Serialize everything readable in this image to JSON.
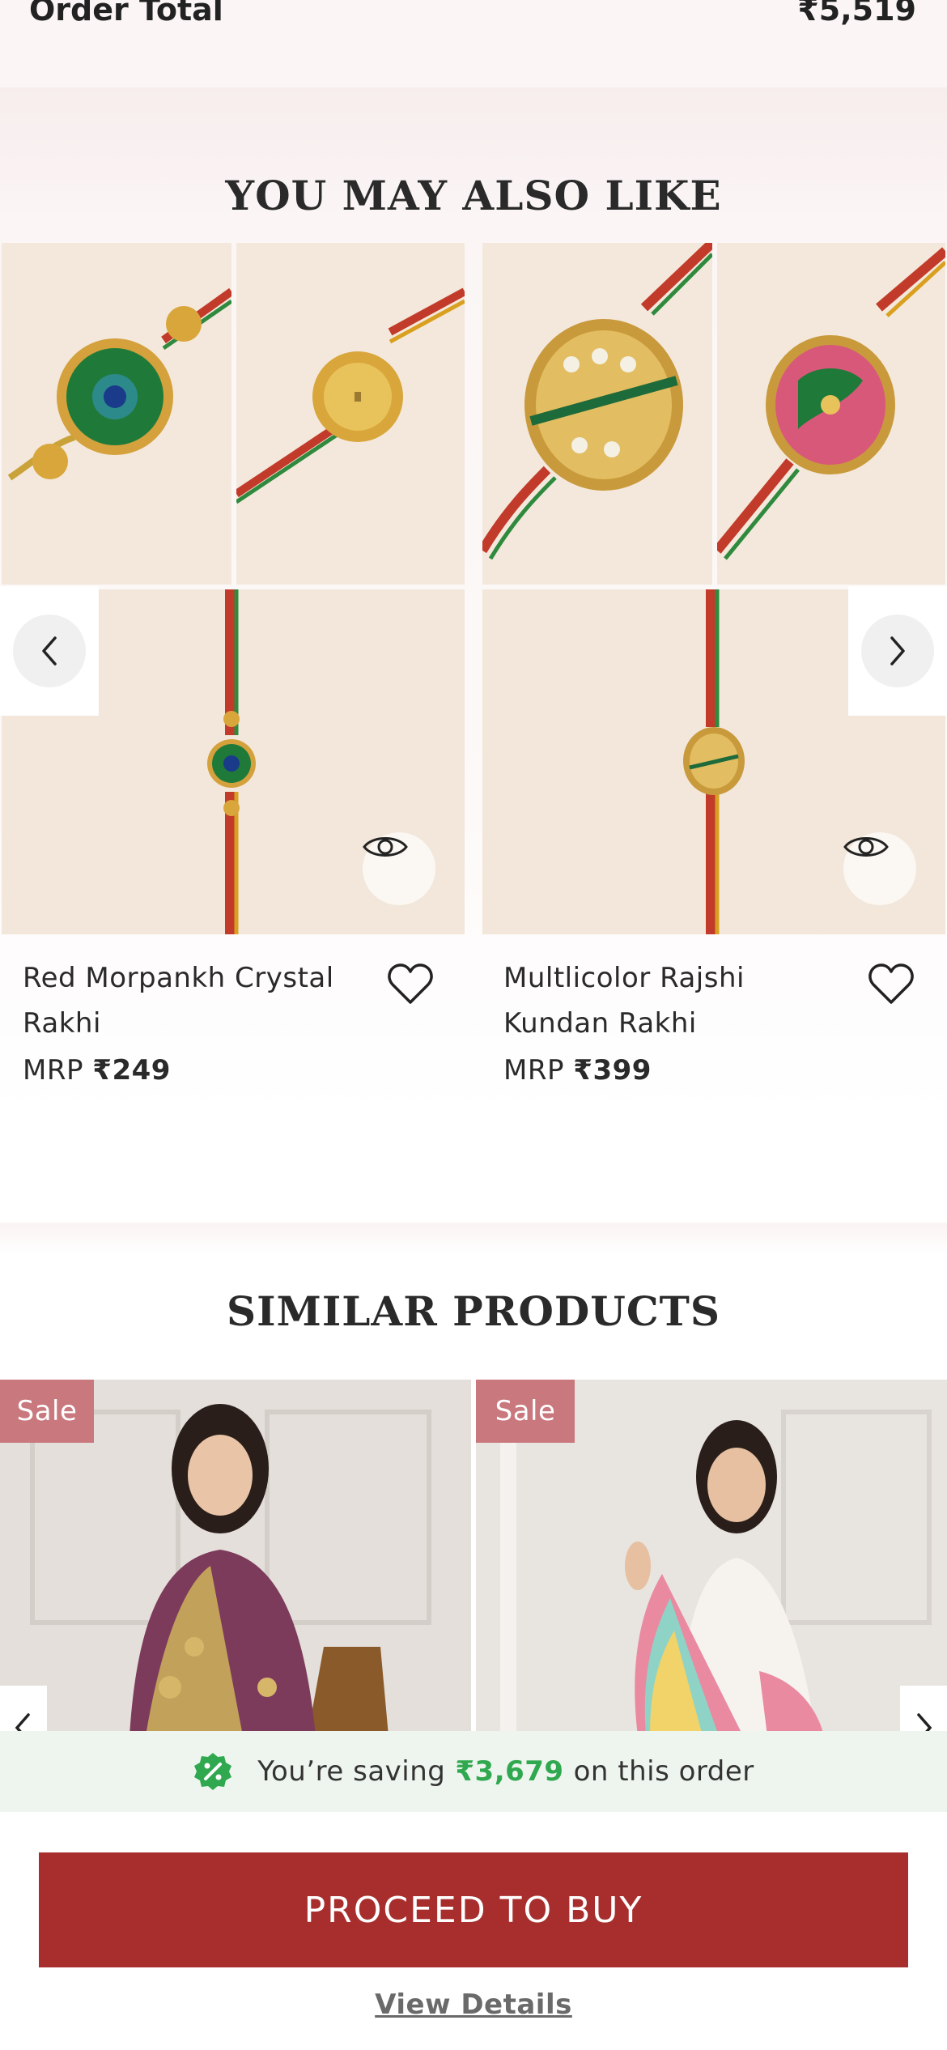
{
  "order_summary": {
    "label": "Order Total",
    "value": "₹5,519"
  },
  "you_may_also_like": {
    "title": "YOU MAY ALSO LIKE",
    "products": [
      {
        "name": "Red Morpankh Crystal Rakhi",
        "price_prefix": "MRP",
        "price": "₹249"
      },
      {
        "name": "Multlicolor Rajshi Kundan Rakhi",
        "price_prefix": "MRP",
        "price": "₹399"
      }
    ]
  },
  "similar_products": {
    "title": "SIMILAR PRODUCTS",
    "badges": [
      "Sale",
      "Sale"
    ]
  },
  "savings": {
    "prefix": "You’re saving",
    "amount": "₹3,679",
    "suffix": "on this order"
  },
  "actions": {
    "buy_label": "PROCEED TO BUY",
    "details_label": "View Details"
  },
  "colors": {
    "accent": "#a82e2e",
    "savings_green": "#2fa84f",
    "sale_badge": "#c9787e"
  }
}
